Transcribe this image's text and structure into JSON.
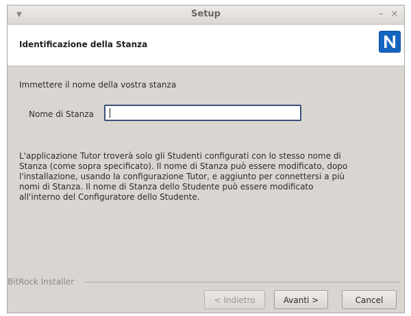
{
  "window": {
    "title": "Setup",
    "menu_icon": "chevron-down-icon",
    "minimize_glyph": "–",
    "close_glyph": "×"
  },
  "header": {
    "title": "Identificazione della Stanza",
    "logo_letter": "N",
    "logo_color": "#1565c0"
  },
  "form": {
    "prompt": "Immettere il nome della vostra stanza",
    "room_label": "Nome di Stanza",
    "room_value": ""
  },
  "info_text": "L'applicazione Tutor troverà solo gli Studenti configurati con lo stesso nome di\nStanza (come sopra specificato).  Il nome di Stanza può essere modificato, dopo\nl'installazione, usando la configurazione Tutor, e aggiunto per connettersi a più\nnomi di Stanza.  Il nome di Stanza dello Studente può essere modificato\nall'interno del Configuratore dello Studente.",
  "footer": {
    "installer_label": "BitRock Installer",
    "back_label": "< Indietro",
    "next_label": "Avanti >",
    "cancel_label": "Cancel"
  }
}
